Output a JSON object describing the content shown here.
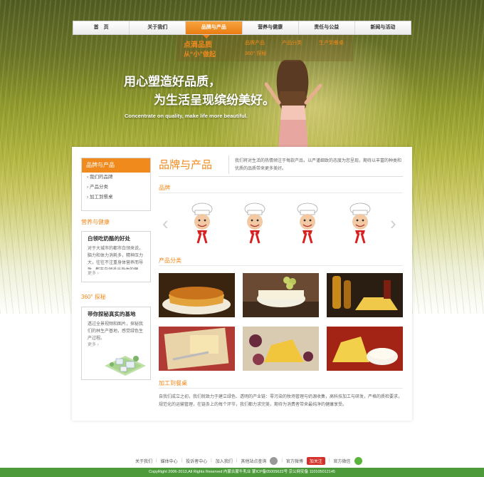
{
  "nav": {
    "items": [
      "首　页",
      "关于我们",
      "品牌与产品",
      "营养与健康",
      "责任与公益",
      "新闻与活动"
    ],
    "active_index": 2
  },
  "dropdown": {
    "brand_line1": "点滴品质",
    "brand_line2": "从“小”做起",
    "links": [
      "品牌产品",
      "产品分类",
      "生产到餐桌",
      "360° 探秘"
    ]
  },
  "hero": {
    "slogan_line1": "用心塑造好品质，",
    "slogan_line2": "为生活呈现缤纷美好。",
    "slogan_en": "Concentrate on quality, make life more beautiful."
  },
  "sidebar": {
    "box_title": "品牌与产品",
    "links": [
      "我们的品牌",
      "产品分类",
      "加工到餐桌"
    ],
    "nutrition": {
      "title": "营养与健康",
      "heading": "白领吃奶酪的好处",
      "text": "对于大城市的都市白领来说，脑力和体力消耗多，精神压力大，往往不注重身体营养而导致...都市白领适当身体的健康...",
      "more": "更多 ›"
    },
    "explore": {
      "title": "360° 探秘",
      "heading": "带你探秘真实的基地",
      "text": "透过全景视频和图片，探秘我们的林生产基地，感觉绿色生产过程。",
      "more": "更多 ›"
    }
  },
  "main": {
    "title": "品牌与产品",
    "intro": "我们将对生活的热情倾注于每款产品，以严谨细致的态度为您呈现，期待以丰富的种类和优质的品质带来更多美好。",
    "brand_section": "品牌",
    "category_section": "产品分类",
    "kitchen_section": "加工到餐桌",
    "kitchen_text": "自我们成立之初，我们就致力于建立绿色、透明的产业链：零污染的牧场管理与奶源收集，高科技加工与研发，严格的质检要求，规范化的运输管理，在链条上的每个环节，我们都力求完美，期待为消费者带来最纯净的健康享受。",
    "arrow_left": "‹",
    "arrow_right": "›",
    "mascot_count": 4
  },
  "footer": {
    "links": [
      "关于我们",
      "媒体中心",
      "投诉者中心",
      "加入我们",
      "其他站点查询"
    ],
    "official_weibo": "官方微博",
    "weibo_button": "加关注",
    "official_wechat": "官方微信",
    "copyright": "CopyRight 2006-2013,All Rights Reserved 内蒙古蒙牛乳业 蒙ICP备05005622号 京公网安备 110105012145"
  },
  "colors": {
    "accent": "#f08a1c",
    "footer_green": "#4c9a3a",
    "weibo_red": "#d5302a"
  }
}
